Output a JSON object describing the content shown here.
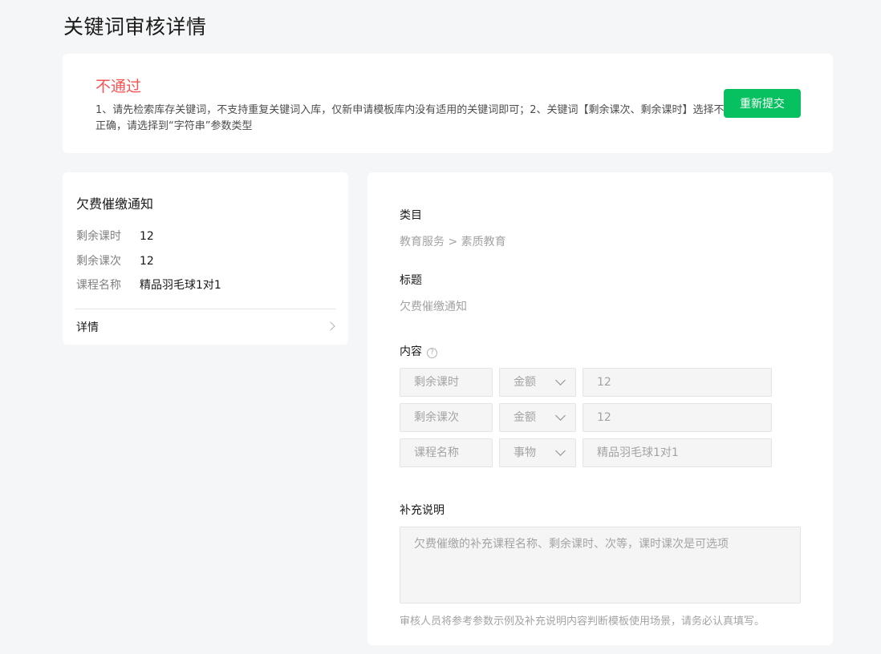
{
  "page": {
    "title": "关键词审核详情"
  },
  "status": {
    "title": "不通过",
    "reason": "1、请先检索库存关键词，不支持重复关键词入库，仅新申请模板库内没有适用的关键词即可；2、关键词【剩余课次、剩余课时】选择不正确，请选择到“字符串”参数类型",
    "resubmit_label": "重新提交"
  },
  "preview": {
    "title": "欠费催缴通知",
    "rows": [
      {
        "key": "剩余课时",
        "value": "12"
      },
      {
        "key": "剩余课次",
        "value": "12"
      },
      {
        "key": "课程名称",
        "value": "精品羽毛球1对1"
      }
    ],
    "detail_label": "详情"
  },
  "form": {
    "category_label": "类目",
    "category_value": "教育服务 > 素质教育",
    "title_label": "标题",
    "title_value": "欠费催缴通知",
    "content_label": "内容",
    "help_icon": "?",
    "params": [
      {
        "name": "剩余课时",
        "type": "金额",
        "sample": "12"
      },
      {
        "name": "剩余课次",
        "type": "金额",
        "sample": "12"
      },
      {
        "name": "课程名称",
        "type": "事物",
        "sample": "精品羽毛球1对1"
      }
    ],
    "supplement_label": "补充说明",
    "supplement_placeholder": "欠费催缴的补充课程名称、剩余课时、次等，课时课次是可选项",
    "supplement_hint": "审核人员将参考参数示例及补充说明内容判断模板使用场景，请务必认真填写。"
  },
  "colors": {
    "accent": "#07c160",
    "error": "#fa5151",
    "background": "#f5f6f7"
  }
}
